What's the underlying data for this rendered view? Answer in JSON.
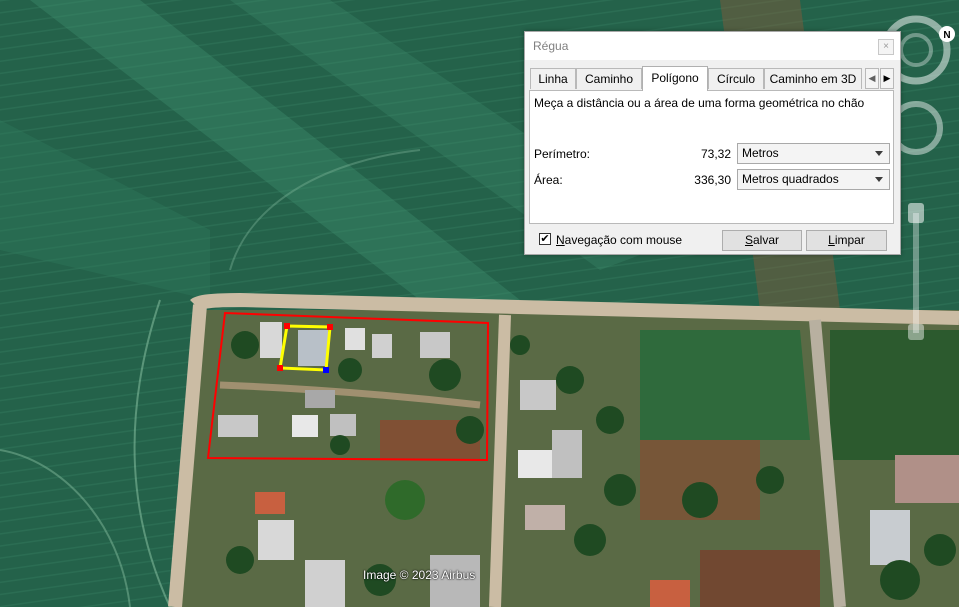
{
  "map": {
    "attribution": "Image © 2023 Airbus",
    "compass_letter": "N"
  },
  "dialog": {
    "title": "Régua",
    "close_symbol": "×",
    "tabs": [
      {
        "label": "Linha",
        "active": false
      },
      {
        "label": "Caminho",
        "active": false
      },
      {
        "label": "Polígono",
        "active": true
      },
      {
        "label": "Círculo",
        "active": false
      },
      {
        "label": "Caminho em 3D",
        "active": false
      }
    ],
    "description": "Meça a distância ou a área de uma forma geométrica no chão",
    "perimeter": {
      "label": "Perímetro:",
      "value": "73,32",
      "unit": "Metros"
    },
    "area": {
      "label": "Área:",
      "value": "336,30",
      "unit": "Metros quadrados"
    },
    "mouse_nav": {
      "label_ul": "N",
      "label_rest": "avegação com mouse",
      "checked": true,
      "check_symbol": "✔"
    },
    "save_button": {
      "ul": "S",
      "rest": "alvar"
    },
    "clear_button": {
      "ul": "L",
      "rest": "impar"
    }
  },
  "colors": {
    "polygon_outline": "#ff0000",
    "measured_polygon": "#ffff00",
    "field": "#24624a",
    "road": "#c8b8a0"
  }
}
